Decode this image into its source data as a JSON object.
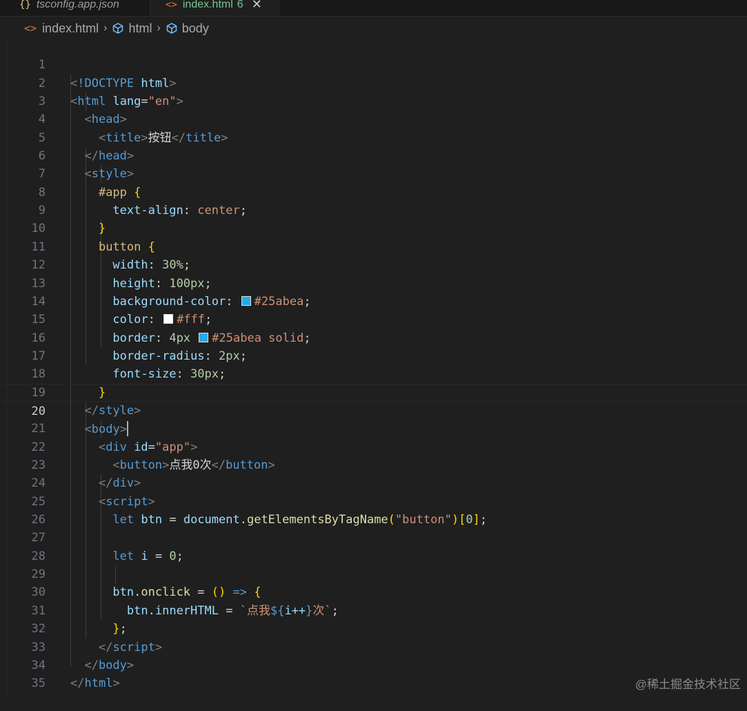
{
  "tabs": [
    {
      "icon": "{}",
      "label": "tsconfig.app.json"
    },
    {
      "icon": "<>",
      "label": "index.html",
      "badge": "6",
      "close": "✕"
    }
  ],
  "breadcrumb": {
    "file_icon": "<>",
    "file": "index.html",
    "sep": "›",
    "items": [
      "html",
      "body"
    ]
  },
  "editor": {
    "active_line": 20,
    "lines": [
      {
        "n": "1"
      },
      {
        "n": "2"
      },
      {
        "n": "3"
      },
      {
        "n": "4"
      },
      {
        "n": "5"
      },
      {
        "n": "6"
      },
      {
        "n": "7"
      },
      {
        "n": "8"
      },
      {
        "n": "9"
      },
      {
        "n": "10"
      },
      {
        "n": "11"
      },
      {
        "n": "12"
      },
      {
        "n": "13"
      },
      {
        "n": "14"
      },
      {
        "n": "15"
      },
      {
        "n": "16"
      },
      {
        "n": "17"
      },
      {
        "n": "18"
      },
      {
        "n": "19"
      },
      {
        "n": "20"
      },
      {
        "n": "21"
      },
      {
        "n": "22"
      },
      {
        "n": "23"
      },
      {
        "n": "24"
      },
      {
        "n": "25"
      },
      {
        "n": "26"
      },
      {
        "n": "27"
      },
      {
        "n": "28"
      },
      {
        "n": "29"
      },
      {
        "n": "30"
      },
      {
        "n": "31"
      },
      {
        "n": "32"
      },
      {
        "n": "33"
      },
      {
        "n": "34"
      },
      {
        "n": "35"
      }
    ],
    "code": {
      "l1_doctype": "!DOCTYPE",
      "l1_html": "html",
      "l2_tag": "html",
      "l2_attr": "lang",
      "l2_val": "\"en\"",
      "l3_tag": "head",
      "l4_tag": "title",
      "l4_text": "按钮",
      "l4_end": "title",
      "l5_tag": "head",
      "l6_tag": "style",
      "l7_sel": "#app",
      "l8_prop": "text-align",
      "l8_val": "center",
      "l10_sel": "button",
      "l11_prop": "width",
      "l11_val": "30%",
      "l12_prop": "height",
      "l12_val": "100px",
      "l13_prop": "background-color",
      "l13_val": "#25abea",
      "l14_prop": "color",
      "l14_val": "#fff",
      "l15_prop": "border",
      "l15_num": "4px",
      "l15_val": "#25abea solid",
      "l16_prop": "border-radius",
      "l16_val": "2px",
      "l17_prop": "font-size",
      "l17_val": "30px",
      "l19_tag": "style",
      "l20_tag": "body",
      "l21_tag": "div",
      "l21_attr": "id",
      "l21_val": "\"app\"",
      "l22_tag": "button",
      "l22_text": "点我0次",
      "l22_end": "button",
      "l23_tag": "div",
      "l24_tag": "script",
      "l25_kw": "let",
      "l25_var": "btn",
      "l25_obj": "document",
      "l25_fn": "getElementsByTagName",
      "l25_str": "\"button\"",
      "l25_idx": "0",
      "l27_kw": "let",
      "l27_var": "i",
      "l27_num": "0",
      "l29_obj": "btn",
      "l29_prop": "onclick",
      "l30_obj": "btn",
      "l30_prop": "innerHTML",
      "l30_str1": "`点我",
      "l30_expr": "i++",
      "l30_str2": "次`",
      "l32_tag": "script",
      "l33_tag": "body",
      "l34_tag": "html"
    }
  },
  "colors": {
    "swatch_blue": "#25abea",
    "swatch_white": "#ffffff"
  },
  "watermark": "@稀土掘金技术社区"
}
